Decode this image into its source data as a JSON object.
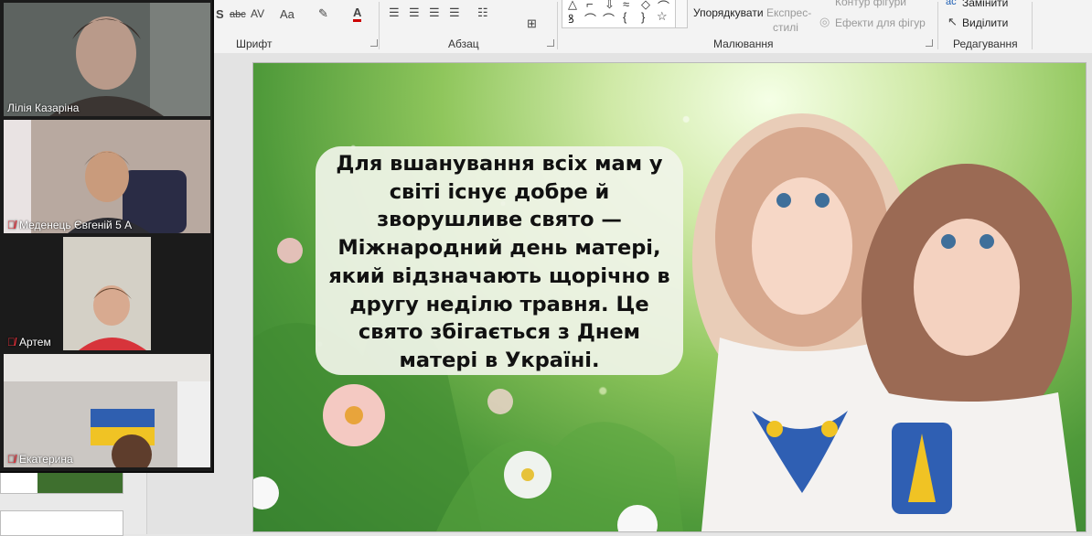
{
  "ribbon": {
    "font_group": "Шрифт",
    "paragraph_group": "Абзац",
    "drawing_group": "Малювання",
    "editing_group": "Редагування",
    "arrange": "Упорядкувати",
    "quick_styles_1": "Експрес-",
    "quick_styles_2": "стилі",
    "shape_outline": "Контур фігури",
    "shape_effects": "Ефекти для фігур",
    "replace": "Замінити",
    "select": "Виділити",
    "font_size_glyph": "Aa",
    "font_color_glyph": "A",
    "char_spacing_glyph": "AV",
    "shadow_glyph": "S",
    "strike_glyph": "abc"
  },
  "participants": [
    {
      "name": "Лілія Казаріна",
      "muted": false
    },
    {
      "name": "Меденець Євгеній 5 А",
      "muted": true
    },
    {
      "name": "Артем",
      "muted": true
    },
    {
      "name": "Екатерина",
      "muted": true
    }
  ],
  "slide": {
    "text_lines": [
      "Для вшанування всіх мам у",
      "світі існує добре й",
      "зворушливе свято —",
      "Міжнародний день матері,",
      "який відзначають щорічно в",
      "другу неділю травня. Це",
      "свято збігається з Днем",
      "матері в Україні."
    ]
  },
  "colors": {
    "active_speaker": "#9cc31a",
    "muted_icon": "#e0303a"
  }
}
